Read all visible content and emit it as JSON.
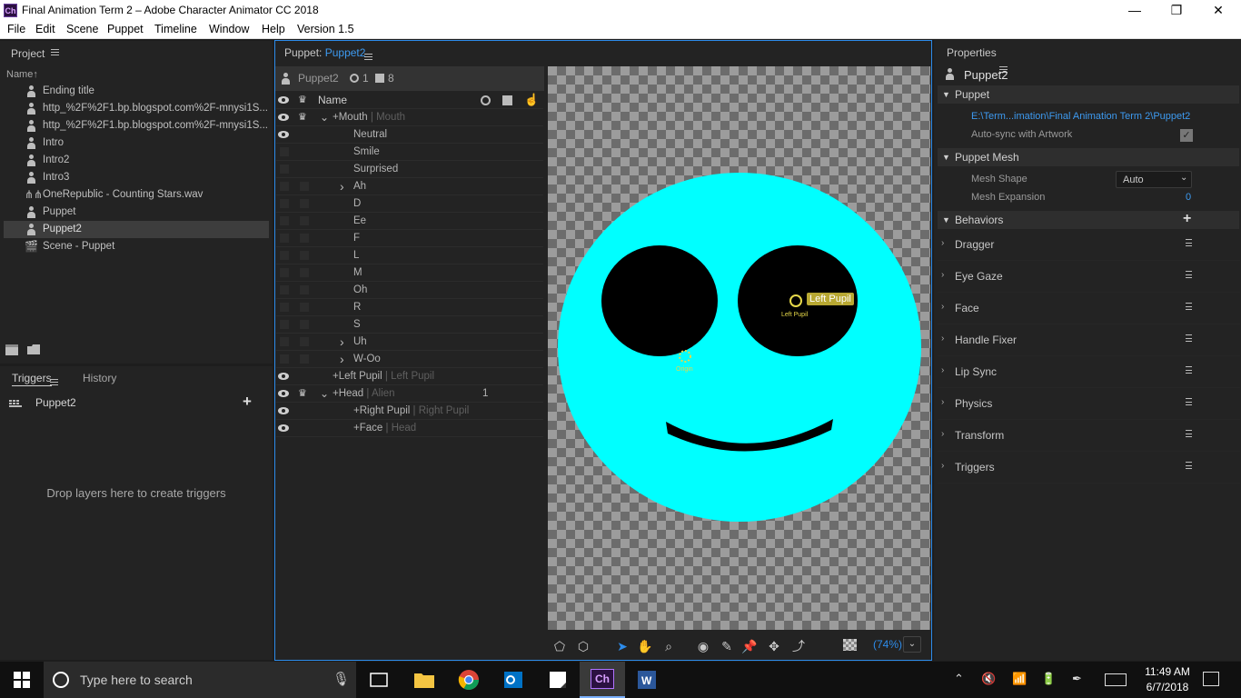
{
  "window": {
    "app_icon_text": "Ch",
    "title": "Final Animation Term 2 – Adobe Character Animator CC 2018",
    "minimize": "—",
    "restore": "❐",
    "close": "✕"
  },
  "menu": [
    "File",
    "Edit",
    "Scene",
    "Puppet",
    "Timeline",
    "Window",
    "Help",
    "Version 1.5"
  ],
  "project": {
    "title": "Project",
    "name_header": "Name",
    "sort_arrow": "↑",
    "items": [
      {
        "label": "Ending title",
        "icon": "puppet-icon"
      },
      {
        "label": "http_%2F%2F1.bp.blogspot.com%2F-mnysi1S...",
        "icon": "puppet-icon"
      },
      {
        "label": "http_%2F%2F1.bp.blogspot.com%2F-mnysi1S...",
        "icon": "puppet-icon"
      },
      {
        "label": "Intro",
        "icon": "puppet-icon"
      },
      {
        "label": "Intro2",
        "icon": "puppet-icon"
      },
      {
        "label": "Intro3",
        "icon": "puppet-icon"
      },
      {
        "label": "OneRepublic - Counting Stars.wav",
        "icon": "audio-icon"
      },
      {
        "label": "Puppet",
        "icon": "puppet-icon"
      },
      {
        "label": "Puppet2",
        "icon": "puppet-icon",
        "selected": true
      },
      {
        "label": "Scene - Puppet",
        "icon": "scene-icon"
      }
    ]
  },
  "triggers": {
    "tab_triggers": "Triggers",
    "tab_history": "History",
    "puppet_name": "Puppet2",
    "empty_text": "Drop layers here to create triggers"
  },
  "puppet_panel": {
    "label": "Puppet:",
    "name": "Puppet2",
    "header_name": "Puppet2",
    "count_handles": "1",
    "count_layers": "8",
    "col_name": "Name",
    "layers": [
      {
        "label": "+Mouth",
        "sub": "Mouth",
        "indent": 1,
        "eye": true,
        "crown": true,
        "chev": "v"
      },
      {
        "label": "Neutral",
        "sub": "",
        "indent": 3,
        "eye": true
      },
      {
        "label": "Smile",
        "sub": "",
        "indent": 3
      },
      {
        "label": "Surprised",
        "sub": "",
        "indent": 3
      },
      {
        "label": "Ah",
        "sub": "",
        "indent": 3,
        "chev": ">"
      },
      {
        "label": "D",
        "sub": "",
        "indent": 3
      },
      {
        "label": "Ee",
        "sub": "",
        "indent": 3
      },
      {
        "label": "F",
        "sub": "",
        "indent": 3
      },
      {
        "label": "L",
        "sub": "",
        "indent": 3
      },
      {
        "label": "M",
        "sub": "",
        "indent": 3
      },
      {
        "label": "Oh",
        "sub": "",
        "indent": 3
      },
      {
        "label": "R",
        "sub": "",
        "indent": 3
      },
      {
        "label": "S",
        "sub": "",
        "indent": 3
      },
      {
        "label": "Uh",
        "sub": "",
        "indent": 3,
        "chev": ">"
      },
      {
        "label": "W-Oo",
        "sub": "",
        "indent": 3,
        "chev": ">"
      },
      {
        "label": "+Left Pupil",
        "sub": "Left Pupil",
        "indent": 0,
        "eye": true
      },
      {
        "label": "+Head",
        "sub": "Alien",
        "indent": 1,
        "eye": true,
        "crown": true,
        "chev": "v",
        "count": "1"
      },
      {
        "label": "+Right Pupil",
        "sub": "Right Pupil",
        "indent": 2,
        "eye": true
      },
      {
        "label": "+Face",
        "sub": "Head",
        "indent": 2,
        "eye": true
      }
    ]
  },
  "canvas": {
    "handle_label": "Left Pupil",
    "handle_small_label": "Left Pupil",
    "origin_label": "Origin",
    "zoom": "(74%)",
    "colors": {
      "face": "#00ffff",
      "eyes": "#000000",
      "handle": "#e6d84a"
    }
  },
  "properties": {
    "title": "Properties",
    "puppet_name": "Puppet2",
    "section_puppet": "Puppet",
    "path": "E:\\Term...imation\\Final Animation Term 2\\Puppet2",
    "autosync_label": "Auto-sync with Artwork",
    "autosync_checked": true,
    "section_mesh": "Puppet Mesh",
    "mesh_shape_label": "Mesh Shape",
    "mesh_shape_value": "Auto",
    "mesh_expansion_label": "Mesh Expansion",
    "mesh_expansion_value": "0",
    "section_behaviors": "Behaviors",
    "behaviors": [
      "Dragger",
      "Eye Gaze",
      "Face",
      "Handle Fixer",
      "Lip Sync",
      "Physics",
      "Transform",
      "Triggers"
    ]
  },
  "taskbar": {
    "search_placeholder": "Type here to search",
    "time": "11:49 AM",
    "date": "6/7/2018",
    "apps": [
      "task-view-icon",
      "file-explorer-icon",
      "chrome-icon",
      "outlook-icon",
      "sticky-notes-icon",
      "character-animator-icon",
      "word-icon"
    ]
  }
}
